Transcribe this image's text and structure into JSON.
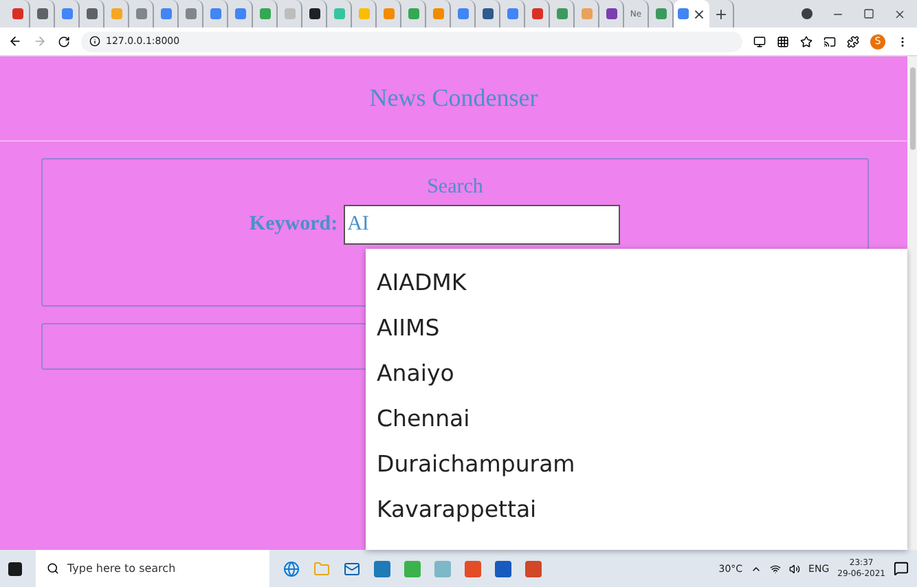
{
  "browser": {
    "tabs": [
      {
        "kind": "favicon",
        "color": "#d93025",
        "selected": false
      },
      {
        "kind": "favicon",
        "color": "#5f6368",
        "selected": false
      },
      {
        "kind": "favicon",
        "color": "#4285f4",
        "selected": false
      },
      {
        "kind": "favicon",
        "color": "#5f6368",
        "selected": false
      },
      {
        "kind": "favicon",
        "color": "#f5a623",
        "selected": false
      },
      {
        "kind": "favicon",
        "color": "#80868b",
        "selected": false
      },
      {
        "kind": "favicon",
        "color": "#4285f4",
        "selected": false
      },
      {
        "kind": "favicon",
        "color": "#80868b",
        "selected": false
      },
      {
        "kind": "favicon",
        "color": "#4285f4",
        "selected": false
      },
      {
        "kind": "favicon",
        "color": "#4285f4",
        "selected": false
      },
      {
        "kind": "favicon",
        "color": "#34a853",
        "selected": false
      },
      {
        "kind": "favicon",
        "color": "#bdbdbd",
        "selected": false
      },
      {
        "kind": "favicon",
        "color": "#202124",
        "selected": false
      },
      {
        "kind": "favicon",
        "color": "#36c5a0",
        "selected": false
      },
      {
        "kind": "favicon",
        "color": "#fbbc04",
        "selected": false
      },
      {
        "kind": "favicon",
        "color": "#f28b00",
        "selected": false
      },
      {
        "kind": "favicon",
        "color": "#34a853",
        "selected": false
      },
      {
        "kind": "favicon",
        "color": "#f28b00",
        "selected": false
      },
      {
        "kind": "favicon",
        "color": "#4285f4",
        "selected": false
      },
      {
        "kind": "favicon",
        "color": "#2d5b8c",
        "selected": false
      },
      {
        "kind": "favicon",
        "color": "#4285f4",
        "selected": false
      },
      {
        "kind": "favicon",
        "color": "#d93025",
        "selected": false
      },
      {
        "kind": "favicon",
        "color": "#3c9a5f",
        "selected": false
      },
      {
        "kind": "favicon",
        "color": "#e8a25a",
        "selected": false
      },
      {
        "kind": "favicon",
        "color": "#7b3fb0",
        "selected": false
      },
      {
        "kind": "text",
        "label": "Ne",
        "selected": false
      },
      {
        "kind": "favicon",
        "color": "#3c9a5f",
        "selected": false
      },
      {
        "kind": "favicon",
        "color": "#4285f4",
        "selected": true
      }
    ],
    "close": "×",
    "new_tab": "+",
    "url": "127.0.0.1:8000",
    "profile": "S"
  },
  "page": {
    "title": "News Condenser",
    "search": {
      "legend": "Search",
      "label": "Keyword:",
      "value": "AI"
    },
    "suggestions": [
      "AIADMK",
      "AIIMS",
      "Anaiyo",
      "Chennai",
      "Duraichampuram",
      "Kavarappettai"
    ]
  },
  "taskbar": {
    "search_placeholder": "Type here to search",
    "weather": "30°C",
    "language": "ENG",
    "time": "23:37",
    "date": "29-06-2021"
  }
}
